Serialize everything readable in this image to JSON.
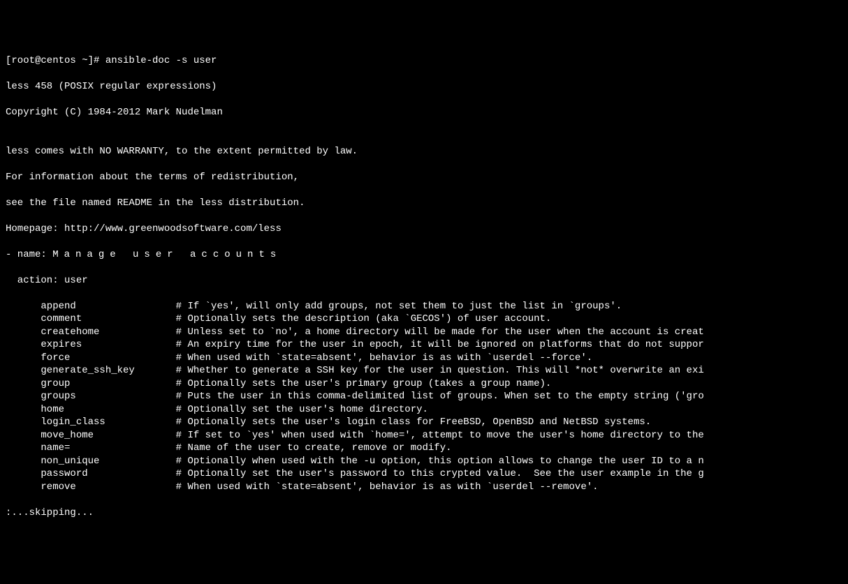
{
  "prompt_line": "[root@centos ~]# ansible-doc -s user",
  "less_version": "less 458 (POSIX regular expressions)",
  "copyright": "Copyright (C) 1984-2012 Mark Nudelman",
  "blank": "",
  "warranty1": "less comes with NO WARRANTY, to the extent permitted by law.",
  "warranty2": "For information about the terms of redistribution,",
  "warranty3": "see the file named README in the less distribution.",
  "homepage": "Homepage: http://www.greenwoodsoftware.com/less",
  "module_name_prefix": "- name: ",
  "module_name_spaced": "Manage user accounts",
  "action_line": "  action: user",
  "params": [
    {
      "name": "append",
      "desc": "# If `yes', will only add groups, not set them to just the list in `groups'."
    },
    {
      "name": "comment",
      "desc": "# Optionally sets the description (aka `GECOS') of user account."
    },
    {
      "name": "createhome",
      "desc": "# Unless set to `no', a home directory will be made for the user when the account is creat"
    },
    {
      "name": "expires",
      "desc": "# An expiry time for the user in epoch, it will be ignored on platforms that do not suppor"
    },
    {
      "name": "force",
      "desc": "# When used with `state=absent', behavior is as with `userdel --force'."
    },
    {
      "name": "generate_ssh_key",
      "desc": "# Whether to generate a SSH key for the user in question. This will *not* overwrite an exi"
    },
    {
      "name": "group",
      "desc": "# Optionally sets the user's primary group (takes a group name)."
    },
    {
      "name": "groups",
      "desc": "# Puts the user in this comma-delimited list of groups. When set to the empty string ('gro"
    },
    {
      "name": "home",
      "desc": "# Optionally set the user's home directory."
    },
    {
      "name": "login_class",
      "desc": "# Optionally sets the user's login class for FreeBSD, OpenBSD and NetBSD systems."
    },
    {
      "name": "move_home",
      "desc": "# If set to `yes' when used with `home=', attempt to move the user's home directory to the"
    },
    {
      "name": "name=",
      "desc": "# Name of the user to create, remove or modify."
    },
    {
      "name": "non_unique",
      "desc": "# Optionally when used with the -u option, this option allows to change the user ID to a n"
    },
    {
      "name": "password",
      "desc": "# Optionally set the user's password to this crypted value.  See the user example in the g"
    },
    {
      "name": "remove",
      "desc": "# When used with `state=absent', behavior is as with `userdel --remove'."
    }
  ],
  "skipping": ":...skipping..."
}
